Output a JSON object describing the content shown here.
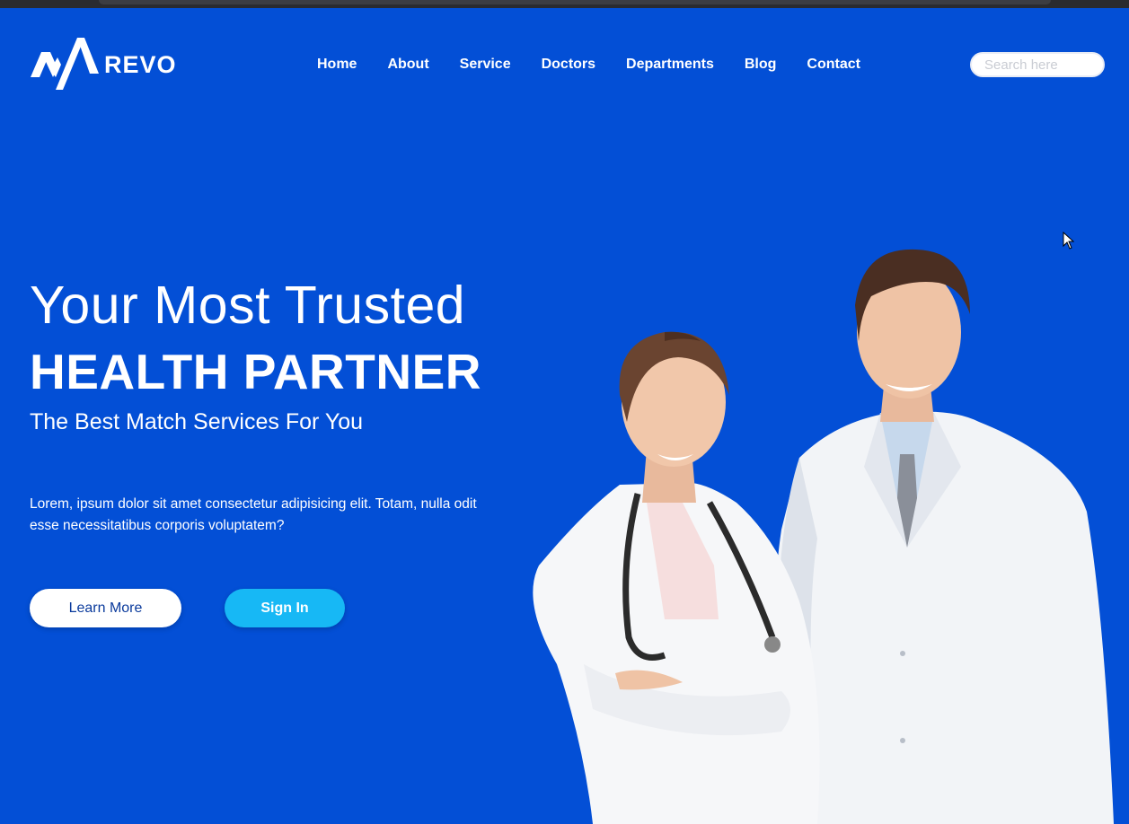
{
  "brand": {
    "name": "REVO",
    "logo_icon": "revo-logo-icon"
  },
  "nav": {
    "items": [
      {
        "label": "Home"
      },
      {
        "label": "About"
      },
      {
        "label": "Service"
      },
      {
        "label": "Doctors"
      },
      {
        "label": "Departments"
      },
      {
        "label": "Blog"
      },
      {
        "label": "Contact"
      }
    ]
  },
  "search": {
    "placeholder": "Search here",
    "value": ""
  },
  "hero": {
    "line1": "Your Most Trusted",
    "line2": "HEALTH PARTNER",
    "line3": "The Best Match Services For You",
    "description": "Lorem, ipsum dolor sit amet consectetur adipisicing elit. Totam, nulla odit esse necessitatibus corporis voluptatem?",
    "learn_more_label": "Learn More",
    "sign_in_label": "Sign In"
  },
  "colors": {
    "background": "#034fd6",
    "accent": "#17b8f5",
    "text": "#ffffff"
  }
}
